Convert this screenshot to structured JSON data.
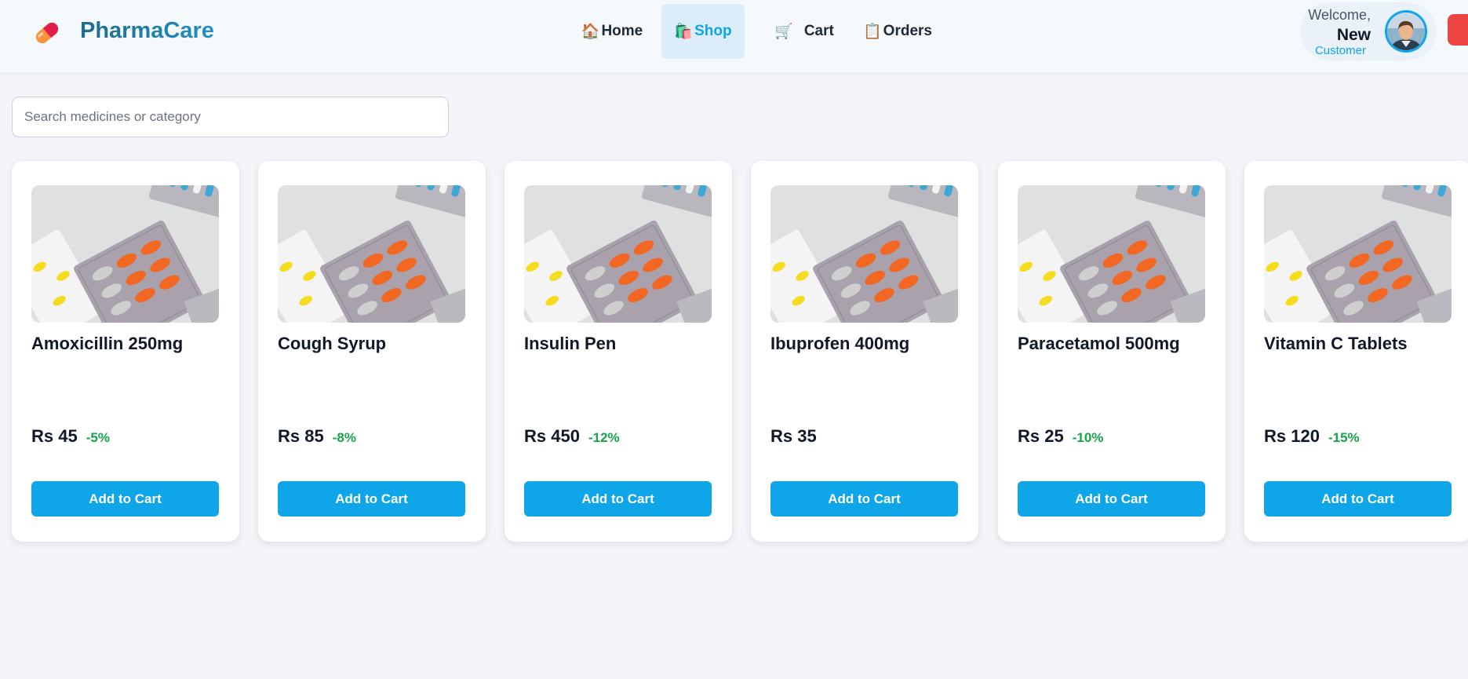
{
  "brand": {
    "name": "PharmaCare",
    "icon": "pill-capsule-icon"
  },
  "nav": [
    {
      "label": "Home",
      "icon": "house-icon",
      "glyph": "🏠",
      "active": false
    },
    {
      "label": "Shop",
      "icon": "shopping-bag-icon",
      "glyph": "🛍️",
      "active": true
    },
    {
      "label": "Cart",
      "icon": "cart-icon",
      "glyph": "🛒",
      "active": false
    },
    {
      "label": "Orders",
      "icon": "clipboard-icon",
      "glyph": "📋",
      "active": false
    }
  ],
  "user": {
    "welcome": "Welcome,",
    "name": "New",
    "role": "Customer"
  },
  "search": {
    "placeholder": "Search medicines or category",
    "value": ""
  },
  "products": [
    {
      "name": "Amoxicillin 250mg",
      "price": "Rs 45",
      "discount": "-5%",
      "button": "Add to Cart"
    },
    {
      "name": "Cough Syrup",
      "price": "Rs 85",
      "discount": "-8%",
      "button": "Add to Cart"
    },
    {
      "name": "Insulin Pen",
      "price": "Rs 450",
      "discount": "-12%",
      "button": "Add to Cart"
    },
    {
      "name": "Ibuprofen 400mg",
      "price": "Rs 35",
      "discount": "",
      "button": "Add to Cart"
    },
    {
      "name": "Paracetamol 500mg",
      "price": "Rs 25",
      "discount": "-10%",
      "button": "Add to Cart"
    },
    {
      "name": "Vitamin C Tablets",
      "price": "Rs 120",
      "discount": "-15%",
      "button": "Add to Cart"
    }
  ],
  "colors": {
    "accent": "#0ea5e9",
    "discount": "#16a34a",
    "logout": "#ef4444",
    "active_nav_bg": "#dcedf9"
  }
}
